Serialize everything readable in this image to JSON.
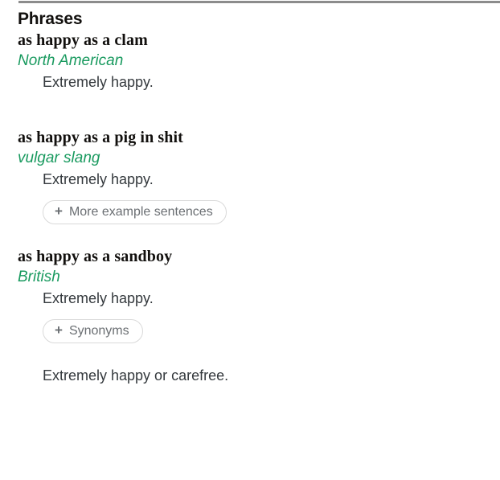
{
  "section": {
    "title": "Phrases"
  },
  "phrases": [
    {
      "headword": "as happy as a clam",
      "region": "North American",
      "definition": "Extremely happy.",
      "action": null
    },
    {
      "headword": "as happy as a pig in shit",
      "region": "vulgar slang",
      "definition": "Extremely happy.",
      "action": {
        "icon": "plus-icon",
        "plus": "+",
        "label": "More example sentences"
      }
    },
    {
      "headword": "as happy as a sandboy",
      "region": "British",
      "definition": "Extremely happy.",
      "action": {
        "icon": "plus-icon",
        "plus": "+",
        "label": "Synonyms"
      }
    }
  ],
  "closing": {
    "text": "Extremely happy or carefree."
  },
  "colors": {
    "region_green": "#199a5f",
    "body_text": "#34393d",
    "heading_text": "#12100e",
    "pill_text": "#6b6f73",
    "pill_border": "#d9d9d9",
    "top_rule": "#8c8c8c",
    "background": "#ffffff"
  }
}
